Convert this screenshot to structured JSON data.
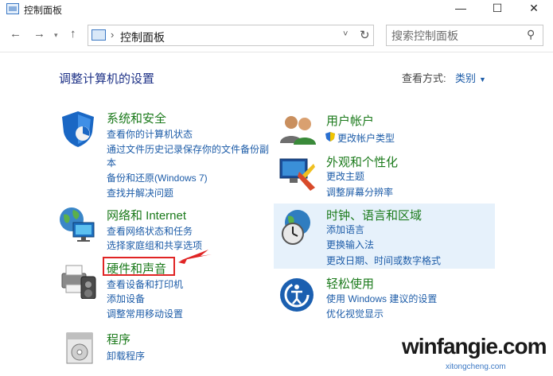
{
  "window": {
    "title": "控制面板",
    "min_icon": "minimize-icon",
    "max_icon": "maximize-icon",
    "close_icon": "close-icon"
  },
  "nav": {
    "back": "←",
    "forward": "→",
    "recent": "▾",
    "up": "↑",
    "address": "控制面板",
    "address_sep": "›",
    "address_chevron": "˅",
    "refresh": "↻",
    "search_placeholder": "搜索控制面板",
    "search_glyph": "⚲"
  },
  "header": {
    "title": "调整计算机的设置",
    "view_by_label": "查看方式:",
    "view_by_value": "类别"
  },
  "categories": {
    "system": {
      "title": "系统和安全",
      "links": [
        "查看你的计算机状态",
        "通过文件历史记录保存你的文件备份副",
        "本",
        "备份和还原(Windows 7)",
        "查找并解决问题"
      ]
    },
    "network": {
      "title": "网络和 Internet",
      "links": [
        "查看网络状态和任务",
        "选择家庭组和共享选项"
      ]
    },
    "hardware": {
      "title": "硬件和声音",
      "links": [
        "查看设备和打印机",
        "添加设备",
        "调整常用移动设置"
      ]
    },
    "programs": {
      "title": "程序",
      "links": [
        "卸载程序"
      ]
    },
    "users": {
      "title": "用户帐户",
      "links": [
        "更改帐户类型"
      ]
    },
    "appearance": {
      "title": "外观和个性化",
      "links": [
        "更改主题",
        "调整屏幕分辨率"
      ]
    },
    "clock": {
      "title": "时钟、语言和区域",
      "links": [
        "添加语言",
        "更换输入法",
        "更改日期、时间或数字格式"
      ]
    },
    "ease": {
      "title": "轻松使用",
      "links": [
        "使用 Windows 建议的设置",
        "优化视觉显示"
      ]
    }
  },
  "watermark": {
    "main": "winfangie.com",
    "sub": "xitongcheng.com"
  },
  "colors": {
    "category_title": "#1b7a1b",
    "link": "#1d5ca8",
    "highlight": "#e6f1fb",
    "annotation": "#e02424"
  }
}
